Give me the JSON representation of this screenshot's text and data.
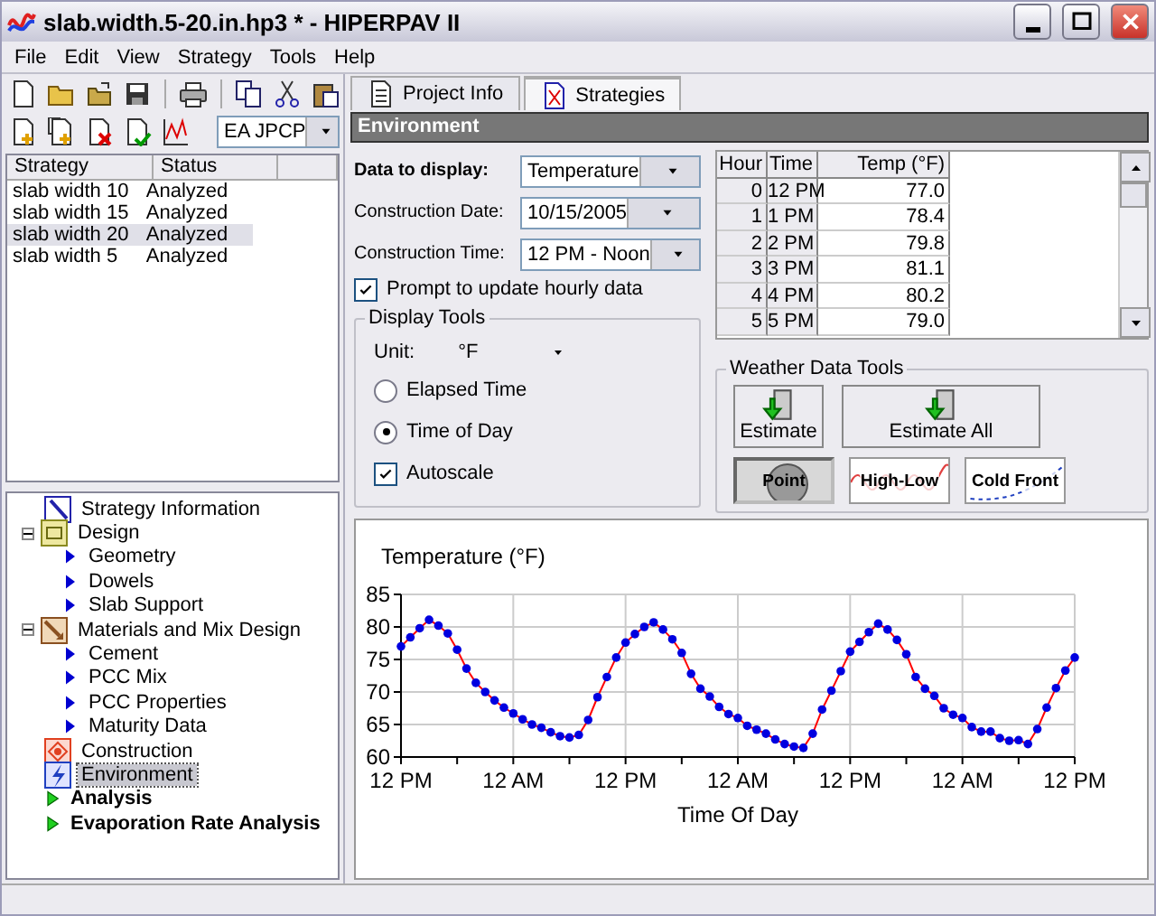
{
  "window": {
    "title": "slab.width.5-20.in.hp3 * - HIPERPAV II"
  },
  "menu": [
    "File",
    "Edit",
    "View",
    "Strategy",
    "Tools",
    "Help"
  ],
  "tabs": [
    {
      "label": "Project Info",
      "selected": false
    },
    {
      "label": "Strategies",
      "selected": true
    }
  ],
  "strategy_selector": {
    "value": "EA JPCP"
  },
  "strategy_table": {
    "columns": [
      "Strategy",
      "Status"
    ],
    "rows": [
      {
        "strategy": "slab width 10",
        "status": "Analyzed",
        "selected": false
      },
      {
        "strategy": "slab width 15",
        "status": "Analyzed",
        "selected": false
      },
      {
        "strategy": "slab width 20",
        "status": "Analyzed",
        "selected": true
      },
      {
        "strategy": "slab width 5",
        "status": "Analyzed",
        "selected": false
      }
    ]
  },
  "tree": [
    {
      "label": "Strategy Information",
      "kind": "section",
      "selected": false
    },
    {
      "label": "Design",
      "kind": "section",
      "expanded": true,
      "selected": false,
      "children": [
        {
          "label": "Geometry",
          "kind": "step",
          "selected": false
        },
        {
          "label": "Dowels",
          "kind": "step",
          "selected": false
        },
        {
          "label": "Slab Support",
          "kind": "step",
          "selected": false
        }
      ]
    },
    {
      "label": "Materials and Mix Design",
      "kind": "section",
      "expanded": true,
      "selected": false,
      "children": [
        {
          "label": "Cement",
          "kind": "step",
          "selected": false
        },
        {
          "label": "PCC Mix",
          "kind": "step",
          "selected": false
        },
        {
          "label": "PCC Properties",
          "kind": "step",
          "selected": false
        },
        {
          "label": "Maturity Data",
          "kind": "step",
          "selected": false
        }
      ]
    },
    {
      "label": "Construction",
      "kind": "section",
      "selected": false
    },
    {
      "label": "Environment",
      "kind": "section",
      "selected": true
    },
    {
      "label": "Analysis",
      "kind": "action",
      "selected": false
    },
    {
      "label": "Evaporation Rate Analysis",
      "kind": "action",
      "selected": false
    }
  ],
  "panel_title": "Environment",
  "form": {
    "data_to_display": {
      "label": "Data to display:",
      "value": "Temperature"
    },
    "construction_date": {
      "label": "Construction Date:",
      "value": "10/15/2005"
    },
    "construction_time": {
      "label": "Construction Time:",
      "value": "12 PM - Noon"
    },
    "prompt_update": {
      "label": "Prompt to update hourly data",
      "checked": true
    }
  },
  "display_tools": {
    "title": "Display Tools",
    "unit_label": "Unit:",
    "unit_value": "°F",
    "radios": [
      {
        "label": "Elapsed Time",
        "selected": false
      },
      {
        "label": "Time of Day",
        "selected": true
      }
    ],
    "autoscale": {
      "label": "Autoscale",
      "checked": true
    }
  },
  "hourly_table": {
    "columns": [
      "Hour",
      "Time",
      "Temp (°F)"
    ],
    "rows": [
      [
        "0",
        "12 PM",
        "77.0"
      ],
      [
        "1",
        "1 PM",
        "78.4"
      ],
      [
        "2",
        "2 PM",
        "79.8"
      ],
      [
        "3",
        "3 PM",
        "81.1"
      ],
      [
        "4",
        "4 PM",
        "80.2"
      ],
      [
        "5",
        "5 PM",
        "79.0"
      ]
    ]
  },
  "weather_tools": {
    "title": "Weather Data Tools",
    "buttons": [
      {
        "label": "Estimate"
      },
      {
        "label": "Estimate All"
      }
    ],
    "styles": [
      {
        "label": "Point",
        "selected": true
      },
      {
        "label": "High-Low",
        "selected": false
      },
      {
        "label": "Cold Front",
        "selected": false
      }
    ]
  },
  "chart": {
    "chart_data": {
      "type": "line",
      "title": "Temperature (°F)",
      "xlabel": "Time Of Day",
      "categories": [
        "12 PM",
        null,
        null,
        null,
        null,
        null,
        null,
        null,
        null,
        null,
        null,
        null,
        "12 AM",
        null,
        null,
        null,
        null,
        null,
        null,
        null,
        null,
        null,
        null,
        null,
        "12 PM",
        null,
        null,
        null,
        null,
        null,
        null,
        null,
        null,
        null,
        null,
        null,
        "12 AM",
        null,
        null,
        null,
        null,
        null,
        null,
        null,
        null,
        null,
        null,
        null,
        "12 PM",
        null,
        null,
        null,
        null,
        null,
        null,
        null,
        null,
        null,
        null,
        null,
        "12 AM",
        null,
        null,
        null,
        null,
        null,
        null,
        null,
        null,
        null,
        null,
        null,
        "12 PM"
      ],
      "grid": true,
      "series": [
        {
          "color": "#ff0000",
          "marker": "circle",
          "values": [
            77.0,
            78.4,
            79.8,
            81.1,
            80.2,
            79.0,
            76.5,
            73.6,
            71.4,
            70.0,
            68.7,
            67.6,
            66.7,
            65.8,
            65.0,
            64.5,
            63.8,
            63.2,
            63.0,
            63.4,
            65.7,
            69.2,
            72.3,
            75.3,
            77.6,
            78.9,
            80.0,
            80.7,
            79.6,
            78.1,
            76.0,
            72.8,
            70.5,
            69.3,
            67.7,
            66.6,
            66.0,
            64.8,
            64.2,
            63.6,
            62.7,
            62.0,
            61.6,
            61.4,
            63.6,
            67.3,
            70.2,
            73.2,
            76.2,
            77.7,
            79.2,
            80.5,
            79.6,
            78.0,
            75.8,
            72.3,
            70.5,
            69.4,
            67.5,
            66.5,
            66.0,
            64.6,
            63.9,
            63.9,
            62.9,
            62.5,
            62.6,
            62.0,
            64.3,
            67.6,
            70.6,
            73.3,
            75.3
          ]
        }
      ],
      "ylim": [
        60,
        85
      ],
      "yticks": [
        60,
        65,
        70,
        75,
        80,
        85
      ]
    }
  }
}
